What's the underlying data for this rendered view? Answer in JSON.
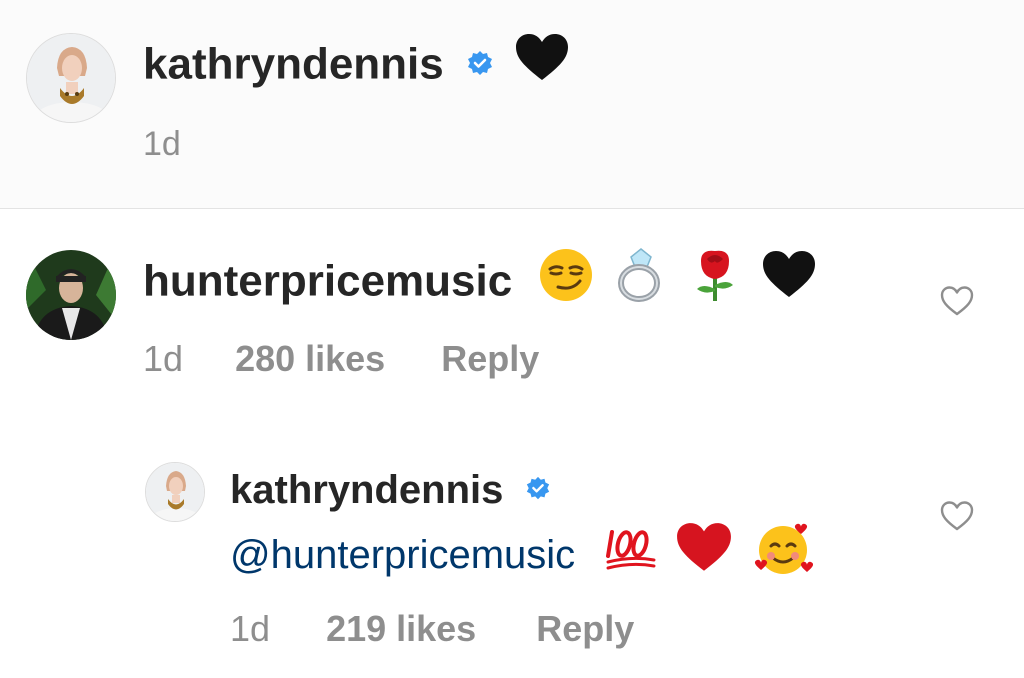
{
  "caption": {
    "username": "kathryndennis",
    "verified": true,
    "emojis": [
      "black-heart"
    ],
    "time": "1d"
  },
  "comments": [
    {
      "username": "hunterpricemusic",
      "emojis": [
        "smirk",
        "ring",
        "rose",
        "black-heart"
      ],
      "time": "1d",
      "likes": "280 likes",
      "reply": "Reply"
    },
    {
      "username": "kathryndennis",
      "verified": true,
      "mention": "@hunterpricemusic",
      "emojis": [
        "hundred-points",
        "red-heart",
        "smiling-face-with-hearts"
      ],
      "time": "1d",
      "likes": "219 likes",
      "reply": "Reply"
    }
  ],
  "colors": {
    "text": "#262626",
    "meta": "#8e8e8e",
    "mention": "#00376b",
    "verified": "#3897f0",
    "caption_bg": "#fbfbfb"
  }
}
